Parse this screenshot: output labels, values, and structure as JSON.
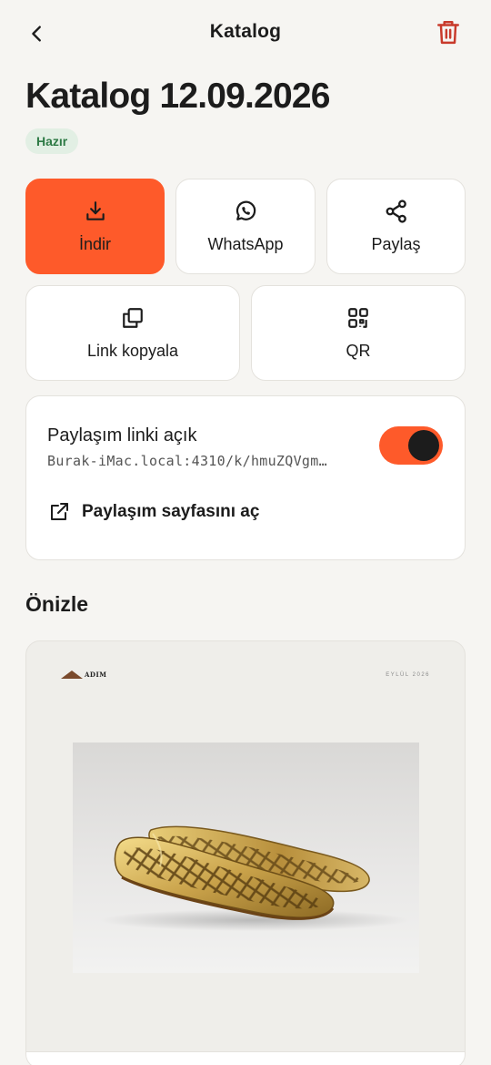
{
  "header": {
    "title": "Katalog",
    "back_icon": "chevron-left-icon",
    "delete_icon": "trash-icon",
    "delete_color": "#c83a2b"
  },
  "catalog": {
    "title": "Katalog 12.09.2026",
    "status": "Hazır"
  },
  "actions": {
    "download": {
      "label": "İndir",
      "icon": "download-icon"
    },
    "whatsapp": {
      "label": "WhatsApp",
      "icon": "whatsapp-icon"
    },
    "share": {
      "label": "Paylaş",
      "icon": "share-icon"
    },
    "copy_link": {
      "label": "Link kopyala",
      "icon": "copy-icon"
    },
    "qr": {
      "label": "QR",
      "icon": "qr-code-icon"
    }
  },
  "share_link": {
    "title": "Paylaşım linki açık",
    "url": "Burak-iMac.local:4310/k/hmuZQVgm…",
    "enabled": true,
    "open_page_label": "Paylaşım sayfasını aç",
    "open_icon": "external-link-icon"
  },
  "preview": {
    "section_title": "Önizle",
    "brand": "ADIM",
    "date_label": "EYLÜL 2026"
  },
  "colors": {
    "accent": "#fe5a2a",
    "background": "#f6f5f2",
    "status_bg": "#e2efe4",
    "status_text": "#2d7a45"
  }
}
